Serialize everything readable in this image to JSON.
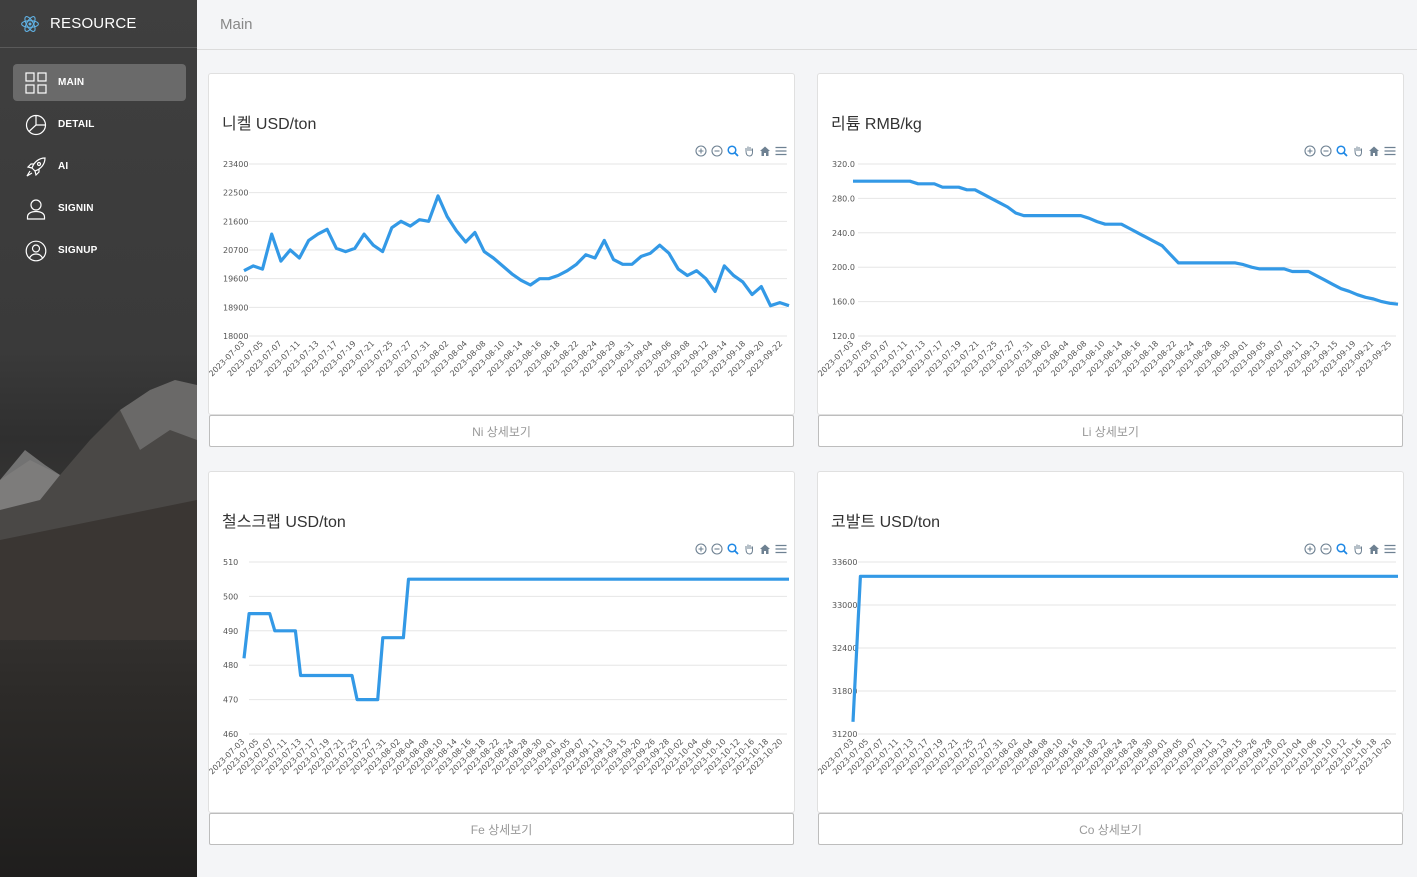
{
  "app": {
    "title": "RESOURCE"
  },
  "sidebar": {
    "items": [
      {
        "label": "MAIN",
        "icon": "grid-icon",
        "active": true
      },
      {
        "label": "DETAIL",
        "icon": "pie-chart-icon",
        "active": false
      },
      {
        "label": "AI",
        "icon": "rocket-icon",
        "active": false
      },
      {
        "label": "SIGNIN",
        "icon": "user-icon",
        "active": false
      },
      {
        "label": "SIGNUP",
        "icon": "user-circle-icon",
        "active": false
      }
    ]
  },
  "header": {
    "title": "Main"
  },
  "colors": {
    "series": "#3399e6",
    "grid": "#e6e6e6",
    "sidebar": "#3d3d3d"
  },
  "cards": [
    {
      "title": "니켈 USD/ton",
      "button_label": "Ni 상세보기",
      "chart_data": {
        "type": "line",
        "ylim": [
          18000,
          23400
        ],
        "yticks": [
          "23400",
          "22500",
          "21600",
          "20700",
          "19600",
          "18900",
          "18000"
        ],
        "xticks": [
          "2023-07-03",
          "2023-07-05",
          "2023-07-07",
          "2023-07-11",
          "2023-07-13",
          "2023-07-17",
          "2023-07-19",
          "2023-07-21",
          "2023-07-25",
          "2023-07-27",
          "2023-07-31",
          "2023-08-02",
          "2023-08-04",
          "2023-08-08",
          "2023-08-10",
          "2023-08-14",
          "2023-08-16",
          "2023-08-18",
          "2023-08-22",
          "2023-08-24",
          "2023-08-29",
          "2023-08-31",
          "2023-09-04",
          "2023-09-06",
          "2023-09-08",
          "2023-09-12",
          "2023-09-14",
          "2023-09-18",
          "2023-09-20",
          "2023-09-22"
        ],
        "values": [
          20050,
          20200,
          20100,
          21200,
          20350,
          20700,
          20450,
          21000,
          21200,
          21350,
          20750,
          20650,
          20750,
          21200,
          20850,
          20650,
          21400,
          21600,
          21450,
          21650,
          21600,
          22400,
          21750,
          21300,
          20950,
          21250,
          20650,
          20450,
          20200,
          19950,
          19750,
          19600,
          19800,
          19800,
          19900,
          20050,
          20250,
          20550,
          20450,
          21000,
          20400,
          20250,
          20250,
          20500,
          20600,
          20850,
          20600,
          20100,
          19900,
          20050,
          19800,
          19400,
          20200,
          19900,
          19700,
          19300,
          19550,
          18950,
          19050,
          18950
        ]
      }
    },
    {
      "title": "리튬 RMB/kg",
      "button_label": "Li 상세보기",
      "chart_data": {
        "type": "line",
        "ylim": [
          120,
          320
        ],
        "yticks": [
          "320.0",
          "280.0",
          "240.0",
          "200.0",
          "160.0",
          "120.0"
        ],
        "xticks": [
          "2023-07-03",
          "2023-07-05",
          "2023-07-07",
          "2023-07-11",
          "2023-07-13",
          "2023-07-17",
          "2023-07-19",
          "2023-07-21",
          "2023-07-25",
          "2023-07-27",
          "2023-07-31",
          "2023-08-02",
          "2023-08-04",
          "2023-08-08",
          "2023-08-10",
          "2023-08-14",
          "2023-08-16",
          "2023-08-18",
          "2023-08-22",
          "2023-08-24",
          "2023-08-28",
          "2023-08-30",
          "2023-09-01",
          "2023-09-05",
          "2023-09-07",
          "2023-09-11",
          "2023-09-13",
          "2023-09-15",
          "2023-09-19",
          "2023-09-21",
          "2023-09-25"
        ],
        "values": [
          300,
          300,
          300,
          300,
          300,
          300,
          300,
          300,
          297,
          297,
          297,
          293,
          293,
          293,
          290,
          290,
          285,
          280,
          275,
          270,
          263,
          260,
          260,
          260,
          260,
          260,
          260,
          260,
          260,
          257,
          253,
          250,
          250,
          250,
          245,
          240,
          235,
          230,
          225,
          215,
          205,
          205,
          205,
          205,
          205,
          205,
          205,
          205,
          203,
          200,
          198,
          198,
          198,
          198,
          195,
          195,
          195,
          190,
          185,
          180,
          175,
          172,
          168,
          165,
          163,
          160,
          158,
          157
        ]
      }
    },
    {
      "title": "철스크랩 USD/ton",
      "button_label": "Fe 상세보기",
      "chart_data": {
        "type": "line",
        "ylim": [
          460,
          510
        ],
        "yticks": [
          "510",
          "500",
          "490",
          "480",
          "470",
          "460"
        ],
        "xticks": [
          "2023-07-03",
          "2023-07-05",
          "2023-07-07",
          "2023-07-11",
          "2023-07-13",
          "2023-07-17",
          "2023-07-19",
          "2023-07-21",
          "2023-07-25",
          "2023-07-27",
          "2023-07-31",
          "2023-08-02",
          "2023-08-04",
          "2023-08-08",
          "2023-08-10",
          "2023-08-14",
          "2023-08-16",
          "2023-08-18",
          "2023-08-22",
          "2023-08-24",
          "2023-08-28",
          "2023-08-30",
          "2023-09-01",
          "2023-09-05",
          "2023-09-07",
          "2023-09-11",
          "2023-09-13",
          "2023-09-15",
          "2023-09-20",
          "2023-09-26",
          "2023-09-28",
          "2023-10-02",
          "2023-10-04",
          "2023-10-06",
          "2023-10-10",
          "2023-10-12",
          "2023-10-16",
          "2023-10-18",
          "2023-10-20"
        ],
        "values": [
          482,
          495,
          495,
          495,
          495,
          495,
          490,
          490,
          490,
          490,
          490,
          477,
          477,
          477,
          477,
          477,
          477,
          477,
          477,
          477,
          477,
          477,
          470,
          470,
          470,
          470,
          470,
          488,
          488,
          488,
          488,
          488,
          505,
          505,
          505,
          505,
          505,
          505,
          505,
          505,
          505,
          505,
          505,
          505,
          505,
          505,
          505,
          505,
          505,
          505,
          505,
          505,
          505,
          505,
          505,
          505,
          505,
          505,
          505,
          505,
          505,
          505,
          505,
          505,
          505,
          505,
          505,
          505,
          505,
          505,
          505,
          505,
          505,
          505,
          505,
          505,
          505,
          505,
          505,
          505,
          505,
          505,
          505,
          505,
          505,
          505,
          505,
          505,
          505,
          505,
          505,
          505,
          505,
          505,
          505,
          505,
          505,
          505,
          505,
          505,
          505,
          505,
          505,
          505,
          505,
          505,
          505
        ]
      }
    },
    {
      "title": "코발트 USD/ton",
      "button_label": "Co 상세보기",
      "chart_data": {
        "type": "line",
        "ylim": [
          31200,
          33600
        ],
        "yticks": [
          "33600",
          "33000",
          "32400",
          "31800",
          "31200"
        ],
        "xticks": [
          "2023-07-03",
          "2023-07-05",
          "2023-07-07",
          "2023-07-11",
          "2023-07-13",
          "2023-07-17",
          "2023-07-19",
          "2023-07-21",
          "2023-07-25",
          "2023-07-27",
          "2023-07-31",
          "2023-08-02",
          "2023-08-04",
          "2023-08-08",
          "2023-08-10",
          "2023-08-16",
          "2023-08-18",
          "2023-08-22",
          "2023-08-24",
          "2023-08-28",
          "2023-08-30",
          "2023-09-01",
          "2023-09-05",
          "2023-09-07",
          "2023-09-11",
          "2023-09-13",
          "2023-09-15",
          "2023-09-26",
          "2023-09-28",
          "2023-10-02",
          "2023-10-04",
          "2023-10-06",
          "2023-10-10",
          "2023-10-12",
          "2023-10-16",
          "2023-10-18",
          "2023-10-20"
        ],
        "values": [
          31370,
          33400,
          33400,
          33400,
          33400,
          33400,
          33400,
          33400,
          33400,
          33400,
          33400,
          33400,
          33400,
          33400,
          33400,
          33400,
          33400,
          33400,
          33400,
          33400,
          33400,
          33400,
          33400,
          33400,
          33400,
          33400,
          33400,
          33400,
          33400,
          33400,
          33400,
          33400,
          33400,
          33400,
          33400,
          33400,
          33400,
          33400,
          33400,
          33400,
          33400,
          33400,
          33400,
          33400,
          33400,
          33400,
          33400,
          33400,
          33400,
          33400,
          33400,
          33400,
          33400,
          33400,
          33400,
          33400,
          33400,
          33400,
          33400,
          33400,
          33400,
          33400,
          33400,
          33400,
          33400,
          33400,
          33400,
          33400,
          33400,
          33400,
          33400,
          33400,
          33400,
          33400,
          33400
        ]
      }
    }
  ]
}
